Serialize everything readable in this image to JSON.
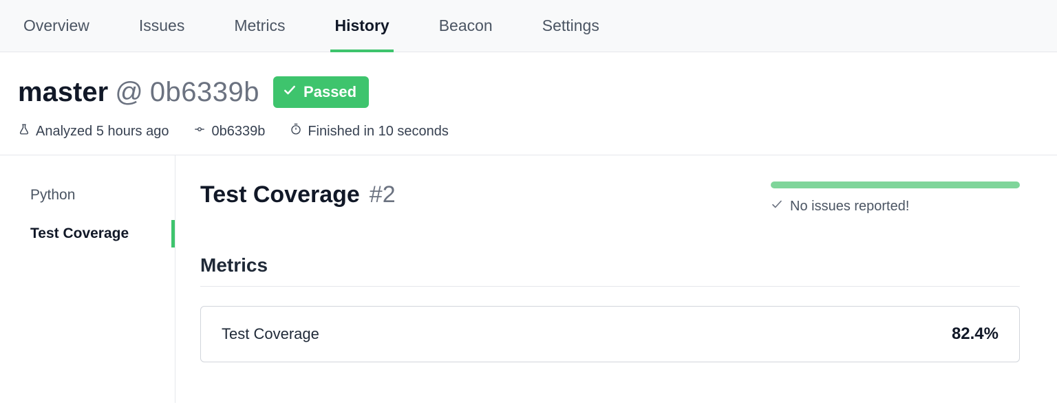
{
  "tabs": [
    {
      "label": "Overview"
    },
    {
      "label": "Issues"
    },
    {
      "label": "Metrics"
    },
    {
      "label": "History",
      "active": true
    },
    {
      "label": "Beacon"
    },
    {
      "label": "Settings"
    }
  ],
  "header": {
    "branch": "master",
    "at": "@",
    "sha": "0b6339b",
    "badge_label": "Passed"
  },
  "meta": {
    "analyzed": "Analyzed 5 hours ago",
    "commit": "0b6339b",
    "duration": "Finished in 10 seconds"
  },
  "sidebar": {
    "items": [
      {
        "label": "Python"
      },
      {
        "label": "Test Coverage",
        "active": true
      }
    ]
  },
  "main": {
    "title": "Test Coverage",
    "run_number": "#2",
    "status_text": "No issues reported!",
    "metrics_heading": "Metrics",
    "metrics": [
      {
        "label": "Test Coverage",
        "value": "82.4%"
      }
    ]
  }
}
